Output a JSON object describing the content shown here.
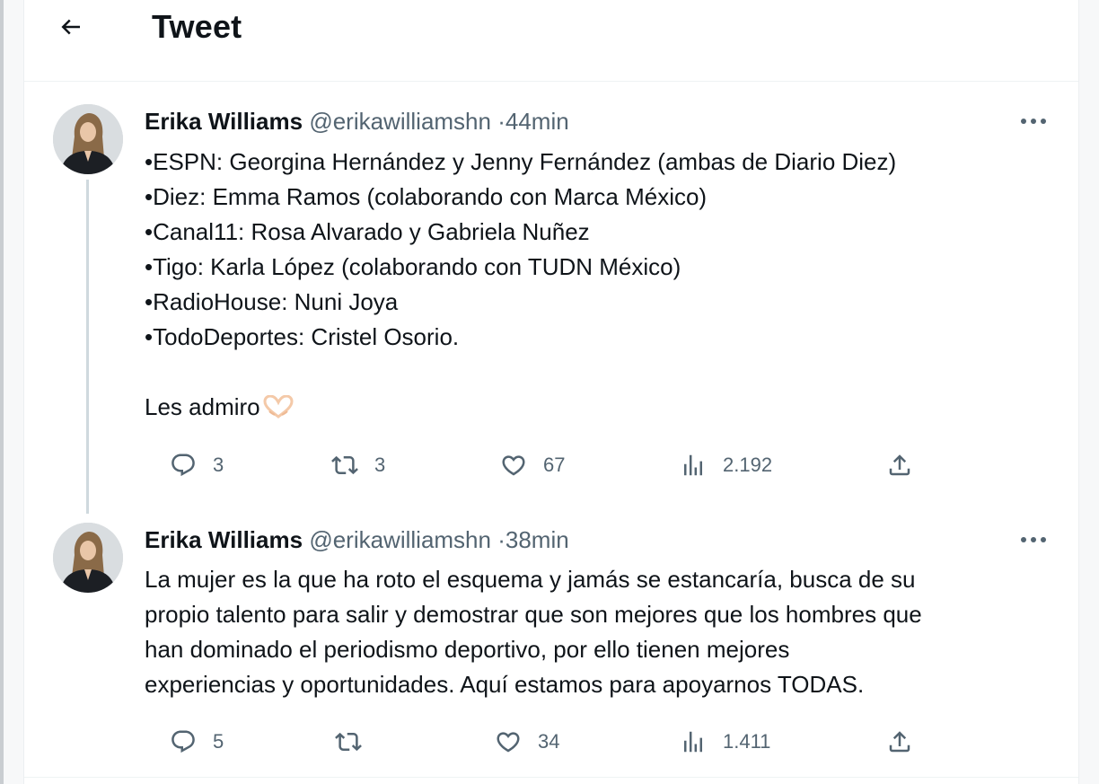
{
  "header": {
    "title": "Tweet"
  },
  "tweets": [
    {
      "name": "Erika Williams",
      "handle": "@erikawilliamshn",
      "separator": "·",
      "time": "44min",
      "lines": [
        "•ESPN: Georgina Hernández y Jenny Fernández (ambas de Diario Diez)",
        "•Diez: Emma Ramos (colaborando con Marca México)",
        "•Canal11: Rosa Alvarado y Gabriela Nuñez",
        "•Tigo: Karla López (colaborando con TUDN México)",
        "•RadioHouse: Nuni Joya",
        "•TodoDeportes: Cristel Osorio.",
        "",
        "Les admiro"
      ],
      "emoji": "heart-hands-icon",
      "replies": "3",
      "retweets": "3",
      "likes": "67",
      "views": "2.192"
    },
    {
      "name": "Erika Williams",
      "handle": "@erikawilliamshn",
      "separator": "·",
      "time": "38min",
      "lines": [
        "La mujer es la que ha roto el esquema y jamás se estancaría, busca de su",
        "propio talento para salir y demostrar que son mejores que los hombres que",
        "han dominado el periodismo deportivo, por ello tienen mejores",
        "experiencias y oportunidades. Aquí estamos para apoyarnos TODAS."
      ],
      "replies": "5",
      "retweets": "",
      "likes": "34",
      "views": "1.411"
    }
  ],
  "colors": {
    "text": "#0f1419",
    "secondary": "#536471",
    "thread": "#cfd9de"
  }
}
